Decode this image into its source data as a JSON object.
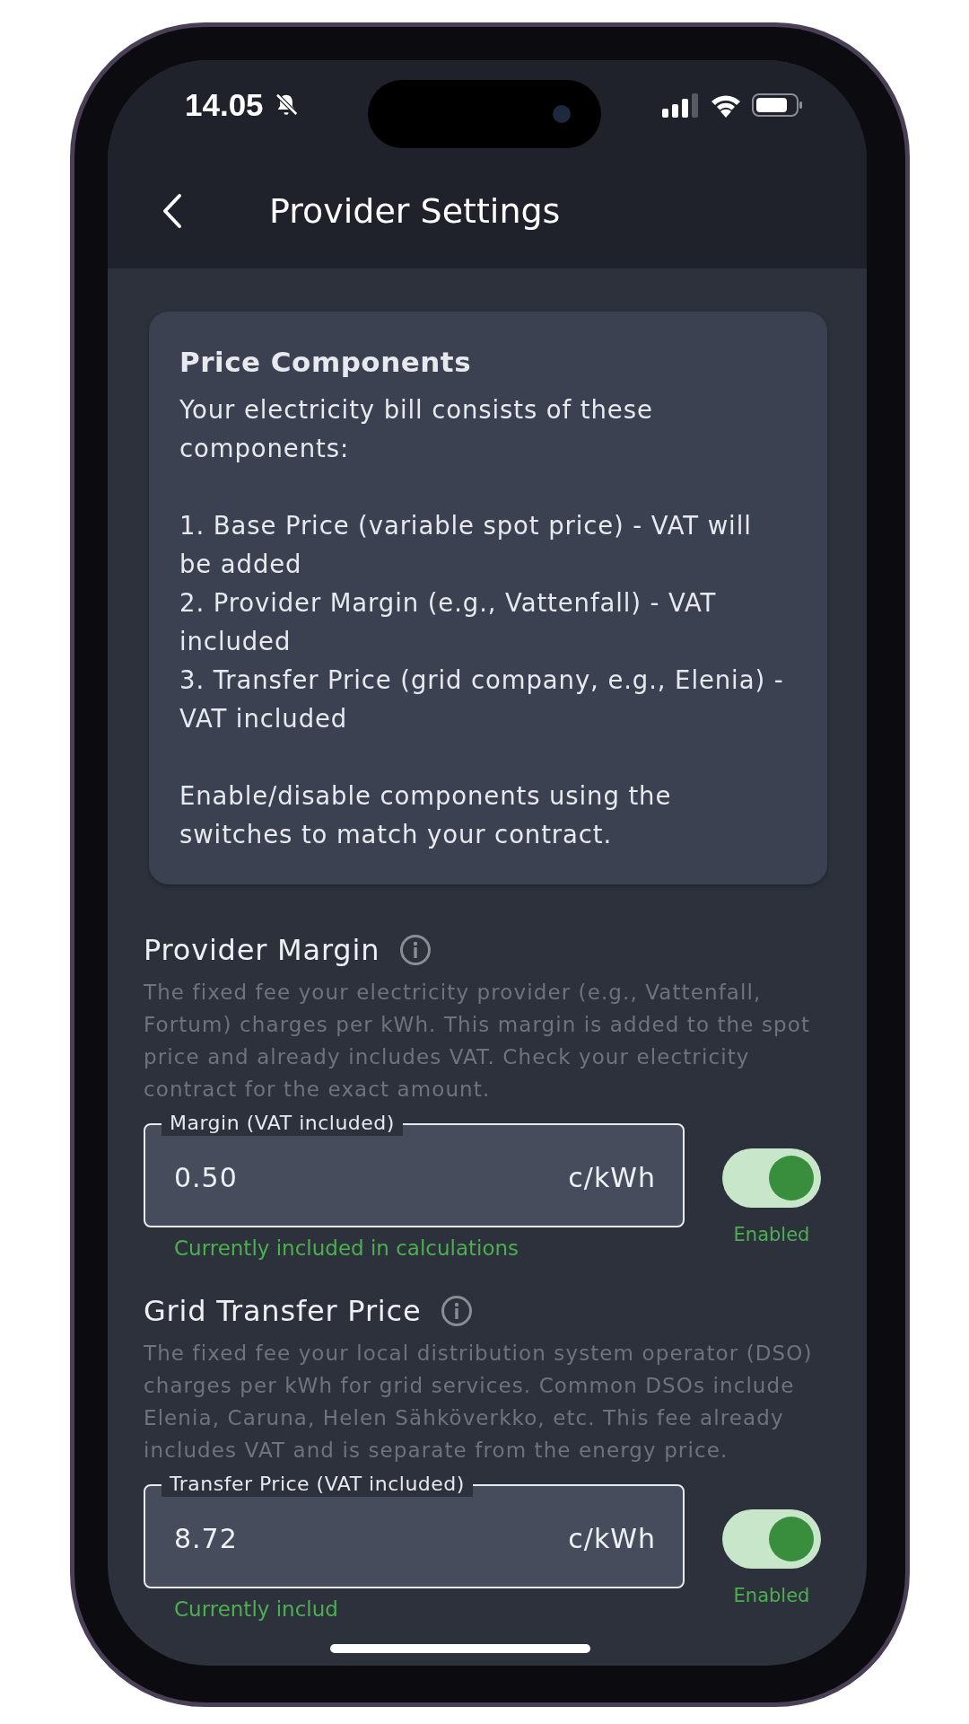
{
  "status_bar": {
    "time": "14.05"
  },
  "app_bar": {
    "title": "Provider Settings"
  },
  "info_card": {
    "title": "Price Components",
    "intro": "Your electricity bill consists of these components:",
    "items": [
      "1. Base Price (variable spot price) - VAT will be added",
      "2. Provider Margin (e.g., Vattenfall) - VAT included",
      "3. Transfer Price (grid company, e.g., Elenia) - VAT included"
    ],
    "note": "Enable/disable components using the switches to match your contract."
  },
  "components": [
    {
      "title": "Provider Margin",
      "description": "The fixed fee your electricity provider (e.g., Vattenfall, Fortum) charges per kWh. This margin is added to the spot price and already includes VAT. Check your electricity contract for the exact amount.",
      "field": {
        "label": "Margin (VAT included)",
        "value": "0.50",
        "unit": "c/kWh"
      },
      "enabled": true,
      "switch_label": "Enabled",
      "helper": "Currently included in calculations"
    },
    {
      "title": "Grid Transfer Price",
      "description": "The fixed fee your local distribution system operator (DSO) charges per kWh for grid services. Common DSOs include Elenia, Caruna, Helen Sähköverkko, etc. This fee already includes VAT and is separate from the energy price.",
      "field": {
        "label": "Transfer Price (VAT included)",
        "value": "8.72",
        "unit": "c/kWh"
      },
      "enabled": true,
      "switch_label": "Enabled",
      "helper": "Currently includ"
    }
  ]
}
